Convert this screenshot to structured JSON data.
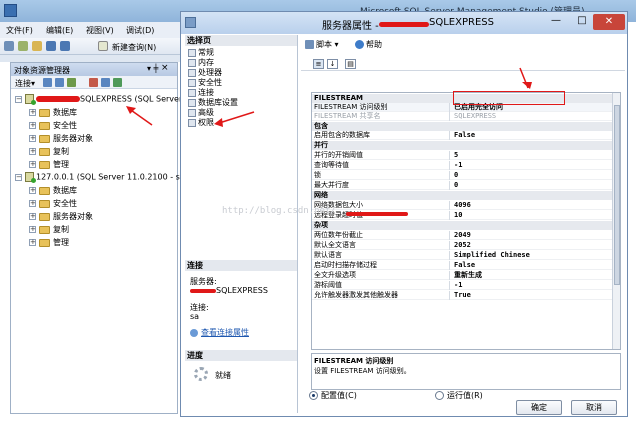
{
  "background_app": {
    "title": "Microsoft SQL Server Management Studio (管理员)",
    "menu": [
      "文件(F)",
      "编辑(E)",
      "视图(V)",
      "调试(D)"
    ],
    "toolbar": {
      "new_query": "新建查询(N)"
    },
    "object_explorer": {
      "title": "对象资源管理器",
      "pin": "▾ ╪",
      "close": "×",
      "connect_label": "连接▾",
      "servers": [
        {
          "name": "SQLEXPRESS (SQL Server",
          "expanded": true,
          "children": [
            "数据库",
            "安全性",
            "服务器对象",
            "复制",
            "管理"
          ]
        },
        {
          "name": "127.0.0.1 (SQL Server 11.0.2100 - sa",
          "expanded": true,
          "children": [
            "数据库",
            "安全性",
            "服务器对象",
            "复制",
            "管理"
          ]
        }
      ]
    }
  },
  "dialog": {
    "title_prefix": "服务器属性 - ",
    "title_server": "SQLEXPRESS",
    "window_controls": {
      "minimize": "—",
      "maximize": "□",
      "close": "✕"
    },
    "select_page": {
      "header": "选择页",
      "pages": [
        "常规",
        "内存",
        "处理器",
        "安全性",
        "连接",
        "数据库设置",
        "高级",
        "权限"
      ],
      "selected": "高级"
    },
    "connection": {
      "header": "连接",
      "server_label": "服务器:",
      "server_value": "SQLEXPRESS",
      "conn_label": "连接:",
      "conn_value": "sa",
      "view_link": "查看连接属性"
    },
    "progress": {
      "header": "进度",
      "status": "就绪"
    },
    "toolbar": {
      "script": "脚本 ▾",
      "help": "帮助"
    },
    "property_grid": {
      "categories": [
        {
          "name": "FILESTREAM",
          "rows": [
            {
              "name": "FILESTREAM 访问级别",
              "value": "已启用完全访问",
              "dim": false
            },
            {
              "name": "FILESTREAM 共享名",
              "value": "SQLEXPRESS",
              "dim": true
            }
          ]
        },
        {
          "name": "包含",
          "rows": [
            {
              "name": "启用包含的数据库",
              "value": "False",
              "dim": false
            }
          ]
        },
        {
          "name": "并行",
          "rows": [
            {
              "name": "并行的开销阈值",
              "value": "5",
              "dim": false
            },
            {
              "name": "查询等待值",
              "value": "-1",
              "dim": false
            },
            {
              "name": "锁",
              "value": "0",
              "dim": false
            },
            {
              "name": "最大并行度",
              "value": "0",
              "dim": false
            }
          ]
        },
        {
          "name": "网络",
          "rows": [
            {
              "name": "网络数据包大小",
              "value": "4096",
              "dim": false
            },
            {
              "name": "远程登录超时值",
              "value": "10",
              "dim": false
            }
          ]
        },
        {
          "name": "杂项",
          "rows": [
            {
              "name": "两位数年份截止",
              "value": "2049",
              "dim": false
            },
            {
              "name": "默认全文语言",
              "value": "2052",
              "dim": false
            },
            {
              "name": "默认语言",
              "value": "Simplified Chinese",
              "dim": false
            },
            {
              "name": "启动时扫描存储过程",
              "value": "False",
              "dim": false
            },
            {
              "name": "全文升级选项",
              "value": "重新生成",
              "dim": false
            },
            {
              "name": "游标阈值",
              "value": "-1",
              "dim": false
            },
            {
              "name": "允许触发器激发其他触发器",
              "value": "True",
              "dim": false
            }
          ]
        }
      ]
    },
    "description": {
      "title": "FILESTREAM 访问级别",
      "text": "设置 FILESTREAM 访问级别。"
    },
    "radio": {
      "configured": "配置值(C)",
      "running": "运行值(R)"
    },
    "buttons": {
      "ok": "确定",
      "cancel": "取消"
    }
  },
  "watermark": "http://blog.csdn.net/",
  "colors": {
    "annotation": "#e01818",
    "titlebar": "#b9d0ec"
  }
}
